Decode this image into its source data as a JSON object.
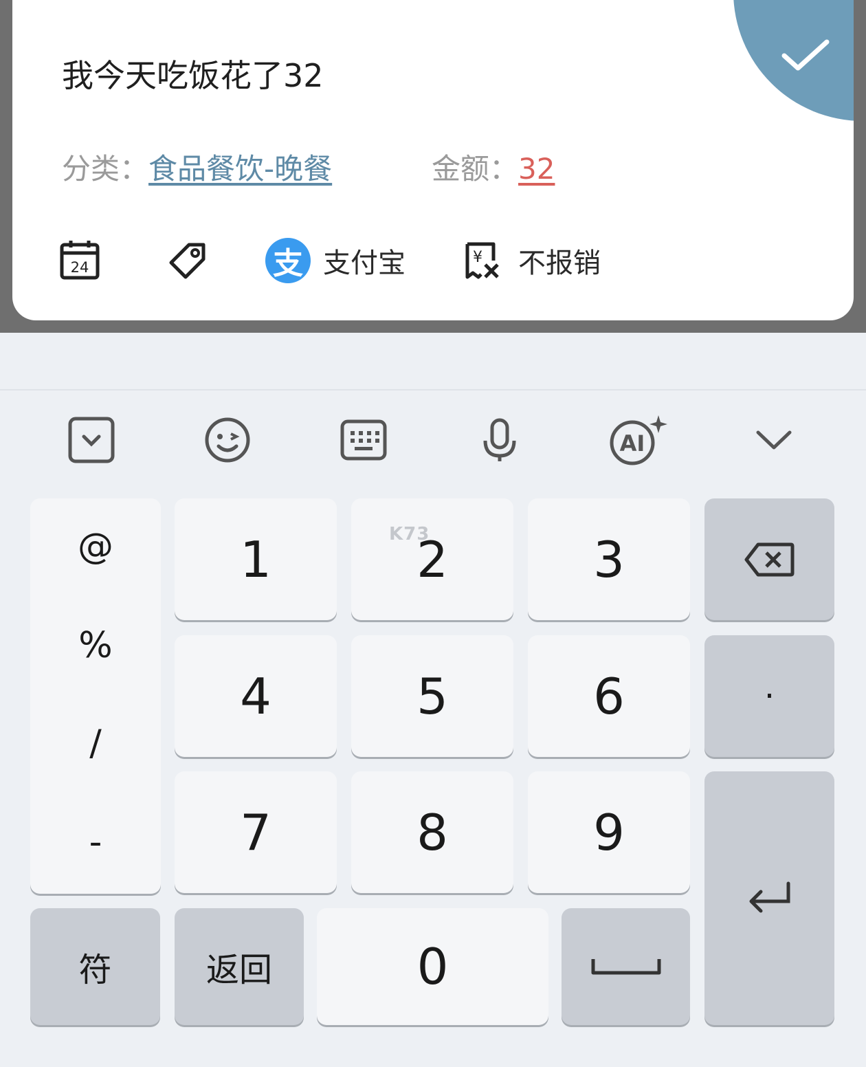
{
  "entry": {
    "text": "我今天吃饭花了32",
    "category_label": "分类：",
    "category_value": "食品餐饮-晚餐",
    "amount_label": "金额：",
    "amount_value": "32"
  },
  "toolbar": {
    "calendar_day": "24",
    "payment_method": "支付宝",
    "alipay_glyph": "支",
    "reimburse": "不报销"
  },
  "keyboard": {
    "symbols": [
      "@",
      "%",
      "/",
      "-"
    ],
    "digits": [
      "1",
      "2",
      "3",
      "4",
      "5",
      "6",
      "7",
      "8",
      "9"
    ],
    "zero": "0",
    "dot": "·",
    "fu": "符",
    "back": "返回",
    "ai": "AI"
  },
  "watermark": "K73",
  "colors": {
    "accent": "#6e9db9",
    "link": "#5e8aa6",
    "amount": "#d9605a",
    "alipay": "#3a9bef"
  }
}
